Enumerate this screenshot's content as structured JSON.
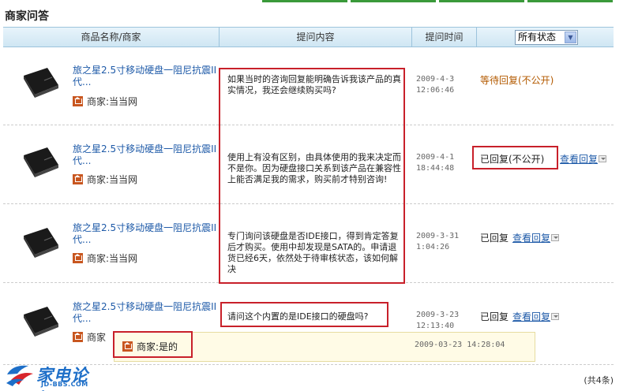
{
  "section": {
    "title": "商家问答"
  },
  "table": {
    "headers": [
      "商品名称/商家",
      "提问内容",
      "提问时间"
    ],
    "status_filter": "所有状态"
  },
  "rows": [
    {
      "product": "旅之星2.5寸移动硬盘一阻尼抗震II代...",
      "merchant": "商家:当当网",
      "question": "如果当时的咨询回复能明确告诉我该产品的真实情况，我还会继续购买吗?",
      "time_date": "2009-4-3",
      "time_clock": "12:06:46",
      "status": "等待回复(不公开)",
      "view_reply": ""
    },
    {
      "product": "旅之星2.5寸移动硬盘一阻尼抗震II代...",
      "merchant": "商家:当当网",
      "question": "使用上有没有区别，由具体使用的我来决定而不是你。因为硬盘接口关系到该产品在兼容性上能否满足我的需求，购买前才特别咨询!",
      "time_date": "2009-4-1",
      "time_clock": "18:44:48",
      "status": "已回复(不公开)",
      "view_reply": "查看回复"
    },
    {
      "product": "旅之星2.5寸移动硬盘一阻尼抗震II代...",
      "merchant": "商家:当当网",
      "question": "专门询问该硬盘是否IDE接口，得到肯定答复后才购买。使用中却发现是SATA的。申请退货已经6天，依然处于待审核状态，该如何解决",
      "time_date": "2009-3-31",
      "time_clock": "1:04:26",
      "status": "已回复",
      "view_reply": "查看回复"
    },
    {
      "product": "旅之星2.5寸移动硬盘一阻尼抗震II代...",
      "merchant": "商家",
      "question": "请问这个内置的是IDE接口的硬盘吗?",
      "time_date": "2009-3-23",
      "time_clock": "12:13:40",
      "status": "已回复",
      "view_reply": "查看回复"
    }
  ],
  "reply": {
    "text": "商家:是的",
    "time": "2009-03-23 14:28:04"
  },
  "footer": {
    "total": "(共4条)"
  },
  "watermark": {
    "name": "家电论坛",
    "url": "JD-BBS.COM"
  },
  "colors": {
    "link": "#1e5aa8",
    "highlight": "#c8202a",
    "header_bg": "#cfe6f3"
  }
}
